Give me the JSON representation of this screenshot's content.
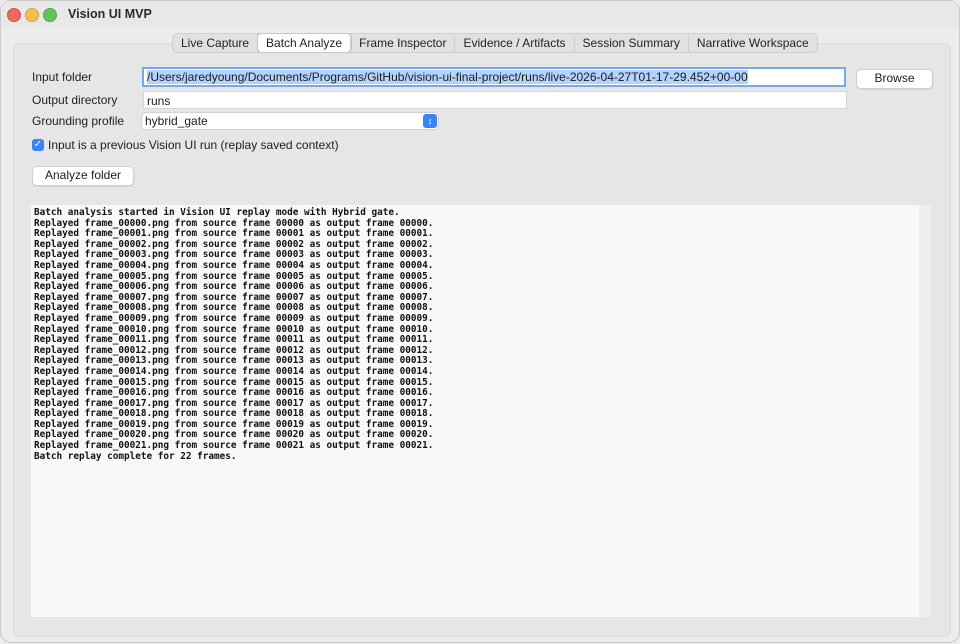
{
  "window": {
    "title": "Vision UI MVP"
  },
  "tabs": [
    {
      "label": "Live Capture",
      "active": false
    },
    {
      "label": "Batch Analyze",
      "active": true
    },
    {
      "label": "Frame Inspector",
      "active": false
    },
    {
      "label": "Evidence / Artifacts",
      "active": false
    },
    {
      "label": "Session Summary",
      "active": false
    },
    {
      "label": "Narrative Workspace",
      "active": false
    }
  ],
  "form": {
    "input_folder_label": "Input folder",
    "input_folder_value": "/Users/jaredyoung/Documents/Programs/GitHub/vision-ui-final-project/runs/live-2026-04-27T01-17-29.452+00-00",
    "browse_label": "Browse",
    "output_dir_label": "Output directory",
    "output_dir_value": "runs",
    "grounding_label": "Grounding profile",
    "grounding_value": "hybrid_gate",
    "replay_checkbox_label": "Input is a previous Vision UI run (replay saved context)",
    "replay_checked": true,
    "analyze_label": "Analyze folder"
  },
  "log": {
    "lines": [
      "Batch analysis started in Vision UI replay mode with Hybrid gate.",
      "Replayed frame_00000.png from source frame 00000 as output frame 00000.",
      "Replayed frame_00001.png from source frame 00001 as output frame 00001.",
      "Replayed frame_00002.png from source frame 00002 as output frame 00002.",
      "Replayed frame_00003.png from source frame 00003 as output frame 00003.",
      "Replayed frame_00004.png from source frame 00004 as output frame 00004.",
      "Replayed frame_00005.png from source frame 00005 as output frame 00005.",
      "Replayed frame_00006.png from source frame 00006 as output frame 00006.",
      "Replayed frame_00007.png from source frame 00007 as output frame 00007.",
      "Replayed frame_00008.png from source frame 00008 as output frame 00008.",
      "Replayed frame_00009.png from source frame 00009 as output frame 00009.",
      "Replayed frame_00010.png from source frame 00010 as output frame 00010.",
      "Replayed frame_00011.png from source frame 00011 as output frame 00011.",
      "Replayed frame_00012.png from source frame 00012 as output frame 00012.",
      "Replayed frame_00013.png from source frame 00013 as output frame 00013.",
      "Replayed frame_00014.png from source frame 00014 as output frame 00014.",
      "Replayed frame_00015.png from source frame 00015 as output frame 00015.",
      "Replayed frame_00016.png from source frame 00016 as output frame 00016.",
      "Replayed frame_00017.png from source frame 00017 as output frame 00017.",
      "Replayed frame_00018.png from source frame 00018 as output frame 00018.",
      "Replayed frame_00019.png from source frame 00019 as output frame 00019.",
      "Replayed frame_00020.png from source frame 00020 as output frame 00020.",
      "Replayed frame_00021.png from source frame 00021 as output frame 00021.",
      "Batch replay complete for 22 frames."
    ]
  },
  "icons": {
    "close": "close-button-icon",
    "minimize": "minimize-button-icon",
    "zoom": "zoom-button-icon",
    "dropdown": "chevron-updown-icon",
    "checkbox": "checkmark-icon"
  },
  "colors": {
    "accent": "#3a82f7",
    "selection": "#b3d3fd",
    "close": "#ec6a5e",
    "minimize": "#f4bf4f",
    "zoom": "#61c554"
  }
}
